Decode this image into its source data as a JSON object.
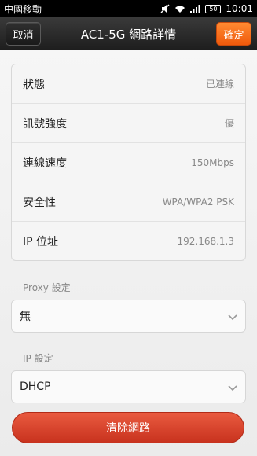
{
  "status_bar": {
    "carrier": "中國移動",
    "battery": "50",
    "time": "10:01"
  },
  "header": {
    "cancel_label": "取消",
    "title": "AC1-5G 網路詳情",
    "confirm_label": "確定"
  },
  "details": [
    {
      "label": "狀態",
      "value": "已連線"
    },
    {
      "label": "訊號強度",
      "value": "優"
    },
    {
      "label": "連線速度",
      "value": "150Mbps"
    },
    {
      "label": "安全性",
      "value": "WPA/WPA2 PSK"
    },
    {
      "label": "IP 位址",
      "value": "192.168.1.3"
    }
  ],
  "proxy": {
    "label": "Proxy 設定",
    "value": "無"
  },
  "ip_settings": {
    "label": "IP 設定",
    "value": "DHCP"
  },
  "forget_button_label": "清除網路",
  "colors": {
    "confirm_orange": "#f26a16",
    "forget_red": "#d63e27",
    "title_bar": "#2a2a2a"
  }
}
